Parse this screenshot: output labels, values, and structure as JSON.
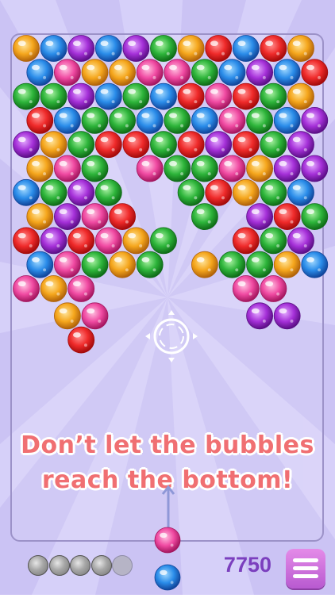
{
  "colors": {
    "background": "#cbc3f4",
    "message": "#f06f72",
    "score": "#7b3fbe",
    "menu_button": "#d275e2"
  },
  "game": {
    "message_line1": "Don’t let the bubbles",
    "message_line2": "reach the bottom!",
    "score": "7750",
    "lives_used": 4,
    "lives_total": 5,
    "loaded_bubble": "pink",
    "next_bubble": "blue",
    "menu_icon": "hamburger-menu-icon",
    "aim_icon": "crosshair-icon"
  },
  "bubble_grid": [
    [
      "orange",
      "blue",
      "purple",
      "blue",
      "purple",
      "green",
      "orange",
      "red",
      "blue",
      "red",
      "orange"
    ],
    [
      null,
      "blue",
      "pink",
      "orange",
      "orange",
      "pink",
      "pink",
      "green",
      "blue",
      "purple",
      "blue",
      "red"
    ],
    [
      "green",
      "green",
      "purple",
      "blue",
      "green",
      "blue",
      "red",
      "pink",
      "red",
      "green",
      "orange"
    ],
    [
      null,
      "red",
      "blue",
      "green",
      "green",
      "blue",
      "green",
      "blue",
      "pink",
      "green",
      "blue",
      "purple"
    ],
    [
      "purple",
      "orange",
      "green",
      "red",
      "red",
      "green",
      "red",
      "purple",
      "red",
      "green",
      "purple"
    ],
    [
      null,
      "orange",
      "pink",
      "green",
      null,
      "pink",
      "green",
      "green",
      "pink",
      "orange",
      "purple",
      "purple"
    ],
    [
      "blue",
      "green",
      "purple",
      "green",
      null,
      null,
      "green",
      "red",
      "orange",
      "green",
      "blue"
    ],
    [
      null,
      "orange",
      "purple",
      "pink",
      "red",
      null,
      null,
      "green",
      null,
      "purple",
      "red",
      "green"
    ],
    [
      "red",
      "purple",
      "red",
      "pink",
      "orange",
      "green",
      null,
      null,
      "red",
      "green",
      "purple"
    ],
    [
      null,
      "blue",
      "pink",
      "green",
      "orange",
      "green",
      null,
      "orange",
      "green",
      "green",
      "orange",
      "blue"
    ],
    [
      "pink",
      "orange",
      "pink",
      null,
      null,
      null,
      null,
      null,
      "pink",
      "pink"
    ],
    [
      null,
      null,
      "orange",
      "pink",
      null,
      null,
      null,
      null,
      null,
      "purple",
      "purple"
    ],
    [
      null,
      null,
      "red"
    ]
  ],
  "palette": {
    "red": [
      "#ff8f8f",
      "#ef2a2a",
      "#a30b0b"
    ],
    "blue": [
      "#9fd8ff",
      "#2a8ce9",
      "#11459a"
    ],
    "green": [
      "#a6f0a0",
      "#2db43a",
      "#0f6b17"
    ],
    "purple": [
      "#e3a7ff",
      "#a530d8",
      "#5b0f86"
    ],
    "orange": [
      "#ffe49a",
      "#f5a61c",
      "#b0620a"
    ],
    "pink": [
      "#ffc0e0",
      "#f04aa2",
      "#a3165e"
    ]
  }
}
